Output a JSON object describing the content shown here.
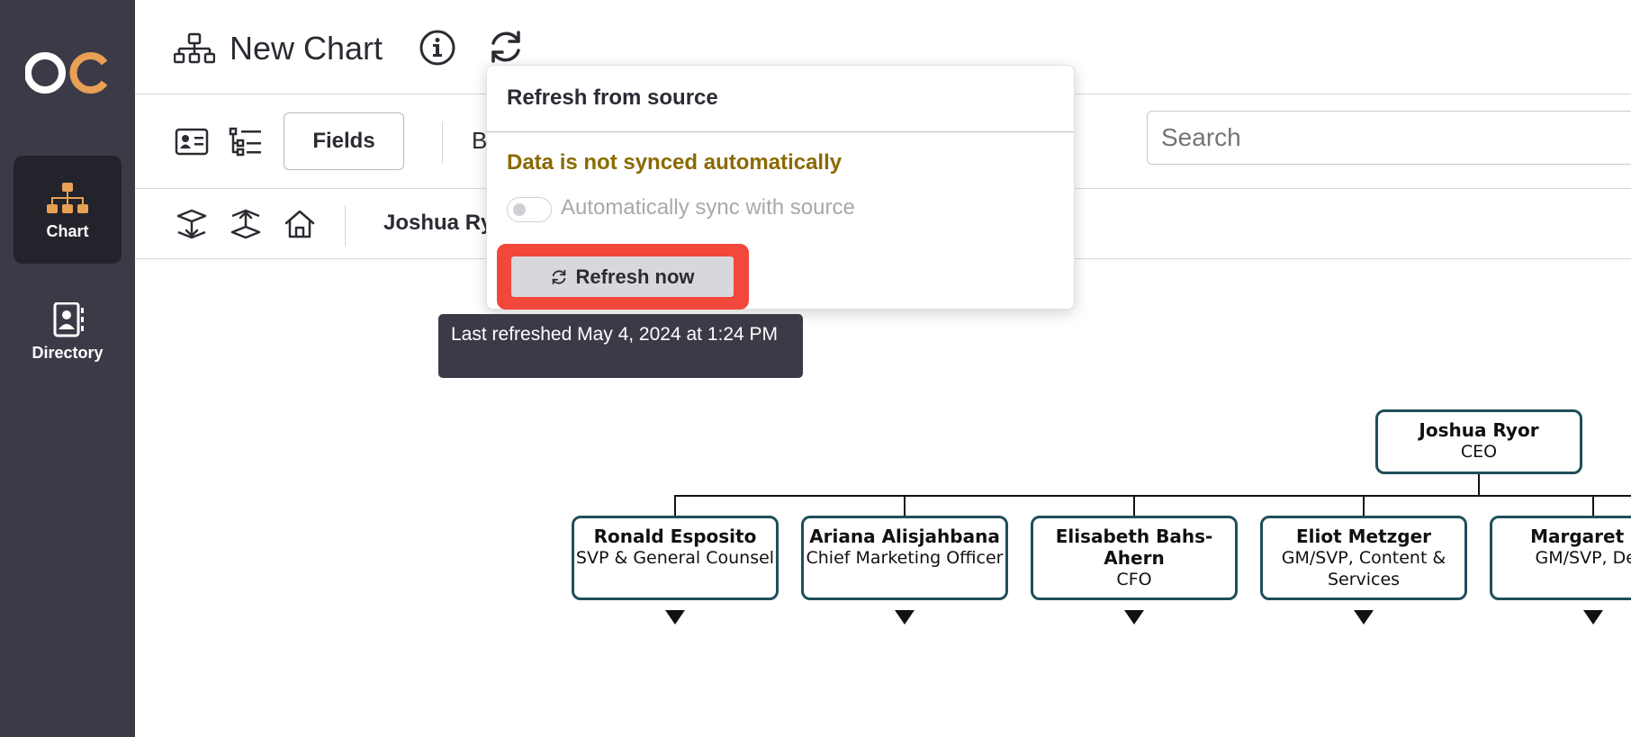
{
  "app": {
    "logo_text": "OC",
    "nav": [
      {
        "label": "Chart",
        "icon": "org-chart-icon",
        "active": true
      },
      {
        "label": "Directory",
        "icon": "contact-book-icon",
        "active": false
      }
    ]
  },
  "header": {
    "title": "New Chart"
  },
  "toolbar": {
    "fields_label": "Fields",
    "obscured_label": "B",
    "search_placeholder": "Search"
  },
  "toolbar2": {
    "breadcrumb": "Joshua Ry"
  },
  "popover": {
    "title": "Refresh from source",
    "warning": "Data is not synced automatically",
    "toggle_label": "Automatically sync with source",
    "toggle_on": false,
    "refresh_button": "Refresh now"
  },
  "tooltip": {
    "text": "Last refreshed May 4, 2024 at 1:24 PM"
  },
  "colors": {
    "sidebar": "#3b3b47",
    "accent_orange": "#e8a055",
    "warning_text": "#8a6a00",
    "highlight": "#f2473b",
    "node_border": "#1f4e5a"
  },
  "org": {
    "root": {
      "name": "Joshua Ryor",
      "title": "CEO"
    },
    "children": [
      {
        "name": "Ronald Esposito",
        "title": "SVP & General Counsel"
      },
      {
        "name": "Ariana Alisjahbana",
        "title": "Chief Marketing Officer"
      },
      {
        "name": "Elisabeth Bahs-Ahern",
        "title": "CFO"
      },
      {
        "name": "Eliot Metzger",
        "title": "GM/SVP, Content & Services"
      },
      {
        "name": "Margaret Be",
        "title": "GM/SVP, Devi"
      }
    ]
  }
}
